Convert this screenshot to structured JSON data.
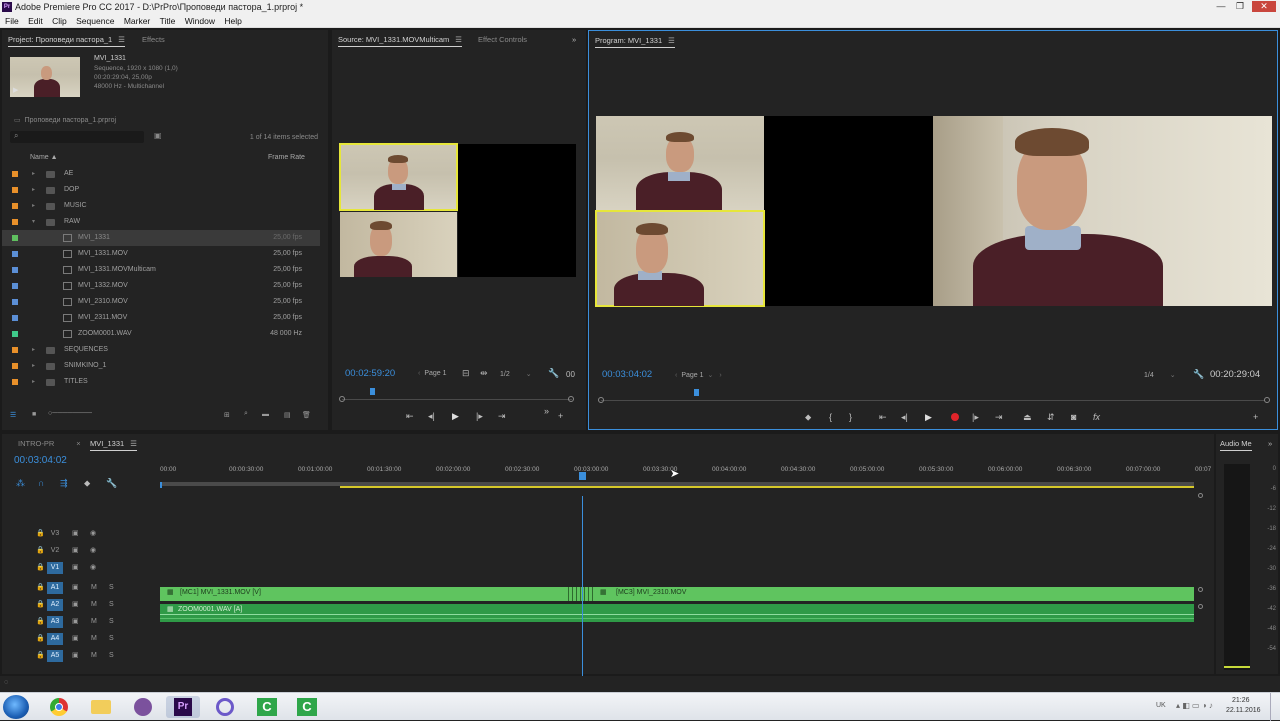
{
  "window": {
    "title": "Adobe Premiere Pro CC 2017 - D:\\PrPro\\Проповеди пастора_1.prproj *",
    "app_icon": "premiere-pro-icon"
  },
  "menu": [
    "File",
    "Edit",
    "Clip",
    "Sequence",
    "Marker",
    "Title",
    "Window",
    "Help"
  ],
  "project": {
    "tab": "Project: Проповеди пастора_1",
    "tab2": "Effects",
    "clip_name": "MVI_1331",
    "clip_info1": "Sequence, 1920 x 1080 (1,0)",
    "clip_info2": "00:20:29:04, 25,00p",
    "clip_info3": "48000 Hz - Multichannel",
    "file": "Проповеди пастора_1.prproj",
    "items_selected": "1 of 14 items selected",
    "col_name": "Name",
    "col_rate": "Frame Rate",
    "rows": [
      {
        "name": "AE",
        "rate": "",
        "color": "#e8902a",
        "type": "folder",
        "indent": 0
      },
      {
        "name": "DOP",
        "rate": "",
        "color": "#e8902a",
        "type": "folder",
        "indent": 0
      },
      {
        "name": "MUSIC",
        "rate": "",
        "color": "#e8902a",
        "type": "folder",
        "indent": 0
      },
      {
        "name": "RAW",
        "rate": "",
        "color": "#e8902a",
        "type": "folder",
        "indent": 0
      },
      {
        "name": "MVI_1331",
        "rate": "25,00 fps",
        "color": "#5fbf5f",
        "type": "seq",
        "indent": 1
      },
      {
        "name": "MVI_1331.MOV",
        "rate": "25,00 fps",
        "color": "#5b8fd6",
        "type": "clip",
        "indent": 1
      },
      {
        "name": "MVI_1331.MOVMulticam",
        "rate": "25,00 fps",
        "color": "#5b8fd6",
        "type": "seq",
        "indent": 1
      },
      {
        "name": "MVI_1332.MOV",
        "rate": "25,00 fps",
        "color": "#5b8fd6",
        "type": "clip",
        "indent": 1
      },
      {
        "name": "MVI_2310.MOV",
        "rate": "25,00 fps",
        "color": "#5b8fd6",
        "type": "clip",
        "indent": 1
      },
      {
        "name": "MVI_2311.MOV",
        "rate": "25,00 fps",
        "color": "#5b8fd6",
        "type": "clip",
        "indent": 1
      },
      {
        "name": "ZOOM0001.WAV",
        "rate": "48 000 Hz",
        "color": "#3fc98a",
        "type": "audio",
        "indent": 1
      },
      {
        "name": "SEQUENCES",
        "rate": "",
        "color": "#e8902a",
        "type": "folder",
        "indent": 0
      },
      {
        "name": "SNIMKINO_1",
        "rate": "",
        "color": "#e8902a",
        "type": "folder",
        "indent": 0
      },
      {
        "name": "TITLES",
        "rate": "",
        "color": "#e8902a",
        "type": "folder",
        "indent": 0
      }
    ]
  },
  "source": {
    "tab": "Source: MVI_1331.MOVMulticam",
    "tab2": "Effect Controls",
    "timecode": "00:02:59:20",
    "page": "Page 1",
    "page_of": "1/2",
    "trailing": "00"
  },
  "program": {
    "tab": "Program: MVI_1331",
    "timecode": "00:03:04:02",
    "page": "Page 1",
    "zoom": "1/4",
    "duration": "00:20:29:04"
  },
  "timeline": {
    "tabs": [
      "INTRO-PR",
      "MVI_1331"
    ],
    "timecode": "00:03:04:02",
    "ruler": [
      "00:00",
      "00:00:30:00",
      "00:01:00:00",
      "00:01:30:00",
      "00:02:00:00",
      "00:02:30:00",
      "00:03:00:00",
      "00:03:30:00",
      "00:04:00:00",
      "00:04:30:00",
      "00:05:00:00",
      "00:05:30:00",
      "00:06:00:00",
      "00:06:30:00",
      "00:07:00:00",
      "00:07"
    ],
    "video_tracks": [
      "V3",
      "V2",
      "V1"
    ],
    "audio_tracks": [
      "A1",
      "A2",
      "A3",
      "A4",
      "A5"
    ],
    "clip1": "[MC1] MVI_1331.MOV [V]",
    "clip2": "[MC3] MVI_2310.MOV",
    "audio_clip": "ZOOM0001.WAV [A]",
    "mute": "M",
    "solo": "S"
  },
  "audio_meter": {
    "title": "Audio Me",
    "scale": [
      "0",
      "-6",
      "-12",
      "-18",
      "-24",
      "-30",
      "-36",
      "-42",
      "-48",
      "-54"
    ]
  },
  "taskbar": {
    "lang": "UK",
    "time": "21:26",
    "date": "22.11.2016",
    "apps": [
      "start-orb-icon",
      "chrome-icon",
      "explorer-folder-icon",
      "viber-icon",
      "premiere-pro-icon",
      "cinema-app-icon",
      "camtasia-icon",
      "camtasia-recorder-icon"
    ]
  }
}
